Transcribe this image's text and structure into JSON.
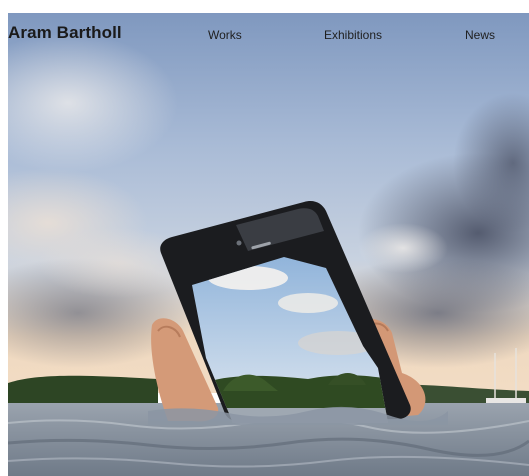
{
  "header": {
    "site_title": "Aram Bartholl",
    "nav": [
      {
        "label": "Works"
      },
      {
        "label": "Exhibitions"
      },
      {
        "label": "News"
      }
    ]
  },
  "colors": {
    "sky_top": "#8fa6c9",
    "sky_mid": "#c4d0e2",
    "horizon_glow": "#f3d8b8",
    "water": "#8d97a6",
    "phone_body": "#1b1c1f",
    "tree_line": "#2f4a22"
  }
}
